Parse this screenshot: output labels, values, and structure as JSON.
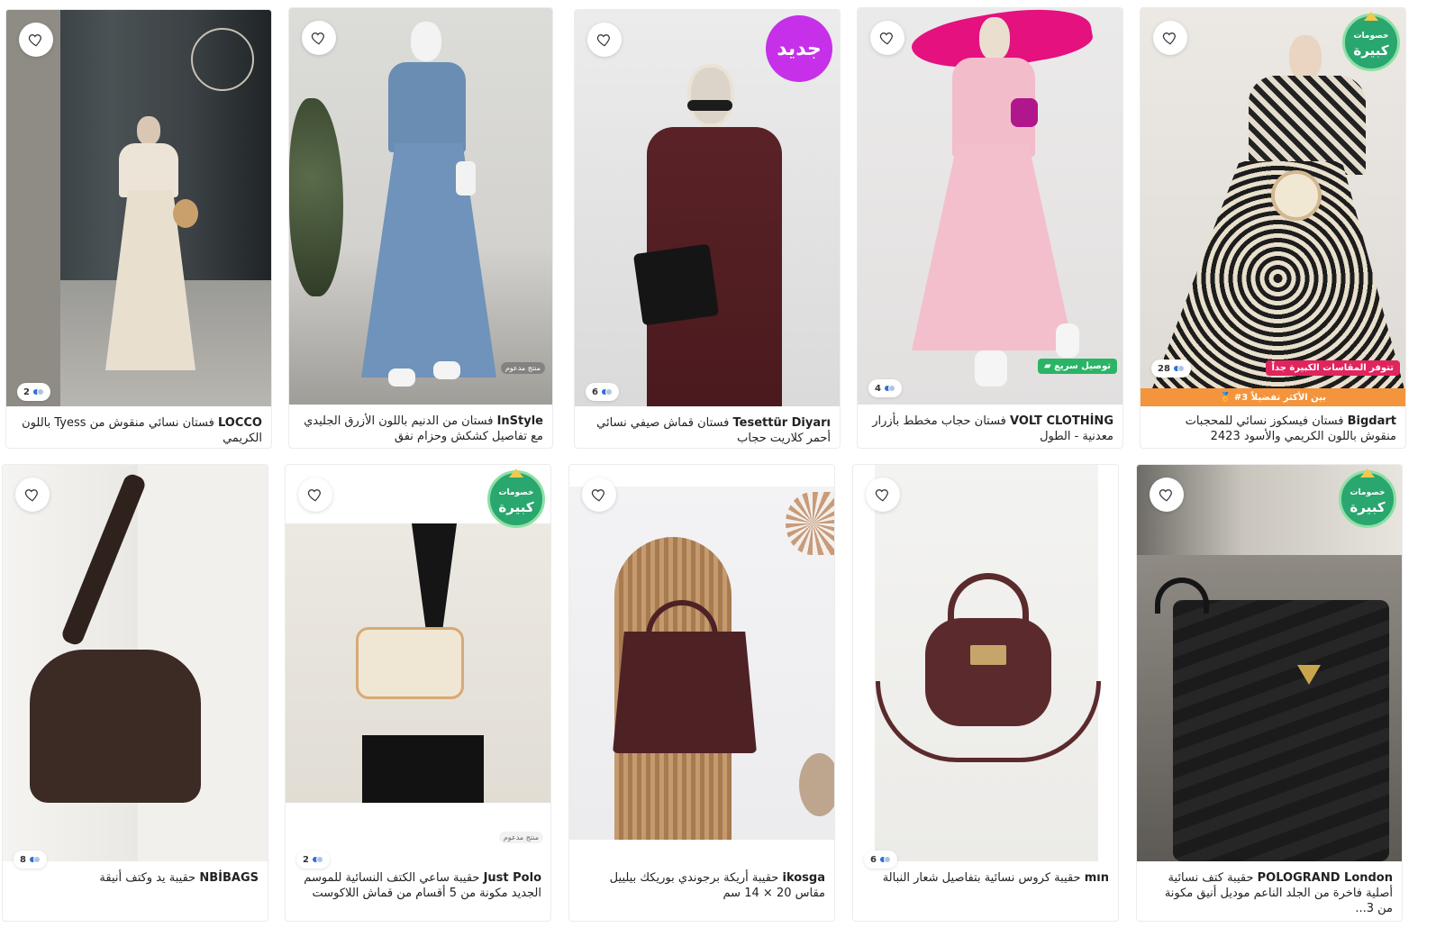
{
  "products": [
    {
      "brand": "LOCCO",
      "name": "فستان نسائي منقوش من Tyess باللون الكريمي",
      "colors_count": "2"
    },
    {
      "brand": "InStyle",
      "name": "فستان من الدنيم باللون الأزرق الجليدي مع تفاصيل كشكش وحزام نفق",
      "sponsored": "منتج مدعوم"
    },
    {
      "brand": "Tesettür Diyarı",
      "name": "فستان قماش صيفي نسائي أحمر كلاريت حجاب",
      "colors_count": "6",
      "badge": "جديد"
    },
    {
      "brand": "VOLT CLOTHİNG",
      "name": "فستان حجاب مخطط بأزرار معدنية - الطول",
      "colors_count": "4",
      "tag": "توصيل سريع"
    },
    {
      "brand": "Bigdart",
      "name": "فستان فيسكوز نسائي للمحجبات منقوش باللون الكريمي والأسود 2423",
      "colors_count": "28",
      "tag": "تتوفر المقاسات الكبيرة جداً",
      "discount_top": "خصومات",
      "discount_bottom": "كبيرة",
      "bar": "#3 بين الأكثر تفضيلاً"
    },
    {
      "brand": "NBİBAGS",
      "name": "حقيبة يد وكتف أنيقة",
      "colors_count": "8"
    },
    {
      "brand": "Just Polo",
      "name": "حقيبة ساعي الكتف النسائية للموسم الجديد مكونة من 5 أقسام من قماش اللاكوست",
      "colors_count": "2",
      "sponsored": "منتج مدعوم",
      "discount_top": "خصومات",
      "discount_bottom": "كبيرة"
    },
    {
      "brand": "ikosga",
      "name": "حقيبة أريكة برجوندي بوريكك بيلييل مقاس 20 × 14 سم"
    },
    {
      "brand": "mın",
      "name": "حقيبة كروس نسائية بتفاصيل شعار النبالة",
      "colors_count": "6"
    },
    {
      "brand": "POLOGRAND London",
      "name": "حقيبة كتف نسائية أصلية فاخرة من الجلد الناعم موديل أنيق مكونة من 3...",
      "discount_top": "خصومات",
      "discount_bottom": "كبيرة"
    }
  ],
  "colors": {
    "new_badge": "#c530e8",
    "discount_green": "#2aa66f",
    "fast_tag": "#2ab566",
    "size_tag": "#e0245e",
    "fav_bar": "#f4943d"
  }
}
